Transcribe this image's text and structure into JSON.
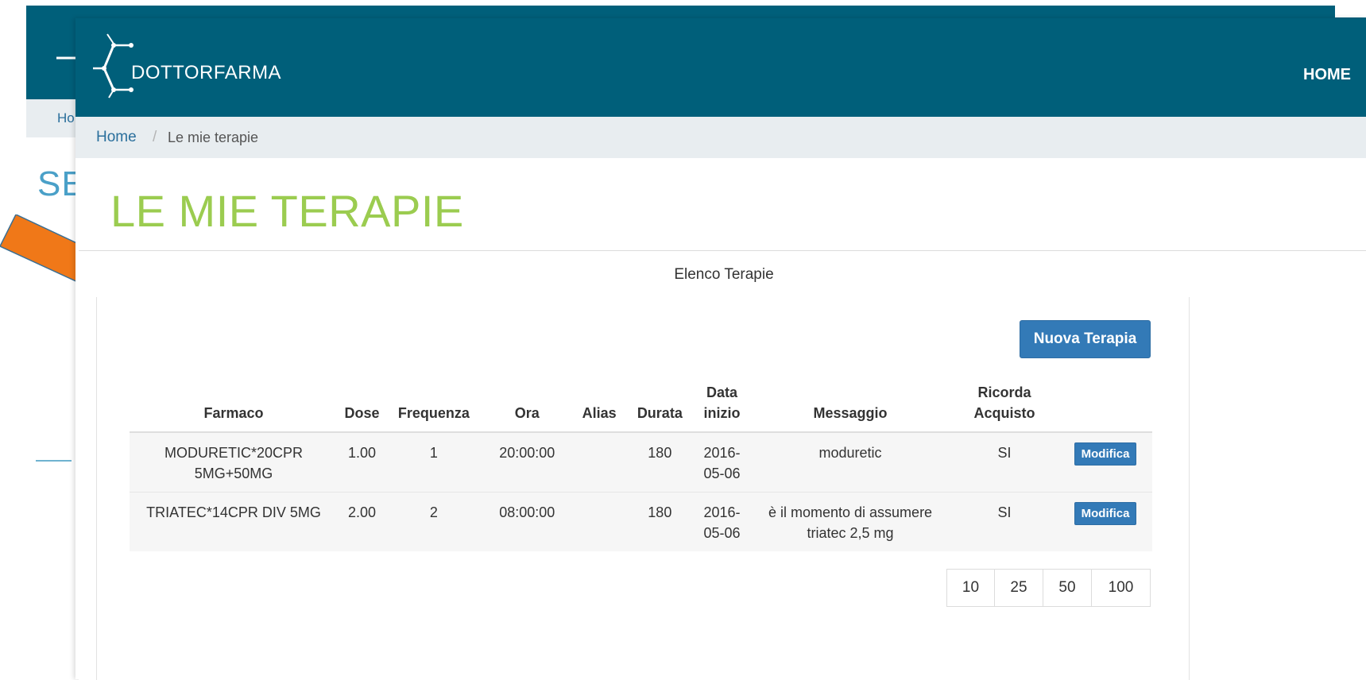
{
  "background_window": {
    "breadcrumb_home_partial": "Ho",
    "title_partial": "SE"
  },
  "navbar": {
    "brand": "DOTTORFARMA",
    "home_link": "HOME"
  },
  "breadcrumb": {
    "home": "Home",
    "separator": "/",
    "current": "Le mie terapie"
  },
  "page_title": "LE MIE TERAPIE",
  "panel": {
    "heading": "Elenco Terapie",
    "new_button": "Nuova Terapia"
  },
  "table": {
    "headers": {
      "farmaco": "Farmaco",
      "dose": "Dose",
      "frequenza": "Frequenza",
      "ora": "Ora",
      "alias": "Alias",
      "durata": "Durata",
      "data_inizio_1": "Data",
      "data_inizio_2": "inizio",
      "messaggio": "Messaggio",
      "ricorda_1": "Ricorda",
      "ricorda_2": "Acquisto"
    },
    "rows": [
      {
        "farmaco_1": "MODURETIC*20CPR",
        "farmaco_2": "5MG+50MG",
        "dose": "1.00",
        "frequenza": "1",
        "ora": "20:00:00",
        "alias": "",
        "durata": "180",
        "data_1": "2016-",
        "data_2": "05-06",
        "messaggio_1": "moduretic",
        "messaggio_2": "",
        "ricorda": "SI",
        "action": "Modifica"
      },
      {
        "farmaco_1": "TRIATEC*14CPR DIV 5MG",
        "farmaco_2": "",
        "dose": "2.00",
        "frequenza": "2",
        "ora": "08:00:00",
        "alias": "",
        "durata": "180",
        "data_1": "2016-",
        "data_2": "05-06",
        "messaggio_1": "è il momento di assumere",
        "messaggio_2": "triatec 2,5 mg",
        "ricorda": "SI",
        "action": "Modifica"
      }
    ]
  },
  "page_length_options": [
    "10",
    "25",
    "50",
    "100"
  ],
  "colors": {
    "navbar": "#005f7a",
    "title_green": "#9bcc50",
    "button_blue": "#337ab7",
    "annotation_arrow": "#f07818"
  }
}
